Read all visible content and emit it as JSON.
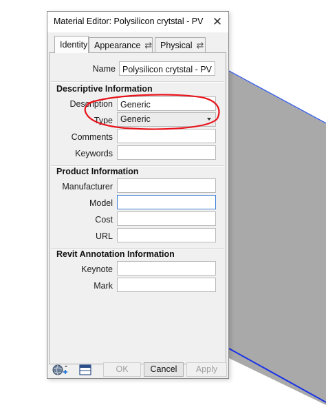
{
  "window": {
    "title": "Material Editor: Polysilicon crytstal - PV",
    "close_glyph": "✕"
  },
  "tabs": [
    {
      "label": "Identity",
      "active": true
    },
    {
      "label": "Appearance",
      "active": false,
      "icon": "swap-icon"
    },
    {
      "label": "Physical",
      "active": false,
      "icon": "swap-icon"
    }
  ],
  "swap_glyph": "⇄",
  "name_field": {
    "label": "Name",
    "value": "Polysilicon crytstal - PV"
  },
  "descriptive": {
    "title": "Descriptive Information",
    "description": {
      "label": "Description",
      "value": "Generic"
    },
    "type": {
      "label": "Type",
      "value": "Generic"
    },
    "comments": {
      "label": "Comments",
      "value": ""
    },
    "keywords": {
      "label": "Keywords",
      "value": ""
    }
  },
  "product": {
    "title": "Product Information",
    "manufacturer": {
      "label": "Manufacturer",
      "value": ""
    },
    "model": {
      "label": "Model",
      "value": ""
    },
    "cost": {
      "label": "Cost",
      "value": ""
    },
    "url": {
      "label": "URL",
      "value": ""
    }
  },
  "revit": {
    "title": "Revit Annotation Information",
    "keynote": {
      "label": "Keynote",
      "value": ""
    },
    "mark": {
      "label": "Mark",
      "value": ""
    }
  },
  "buttons": {
    "ok": "OK",
    "cancel": "Cancel",
    "apply": "Apply"
  },
  "bottom_icons": [
    "globe-add-icon",
    "panel-layout-icon"
  ],
  "colors": {
    "annotation_red": "#e8121a",
    "viewport_gray": "#a9a9a9",
    "edge_blue": "#1a33e6",
    "focus_blue": "#3c7fd6"
  }
}
